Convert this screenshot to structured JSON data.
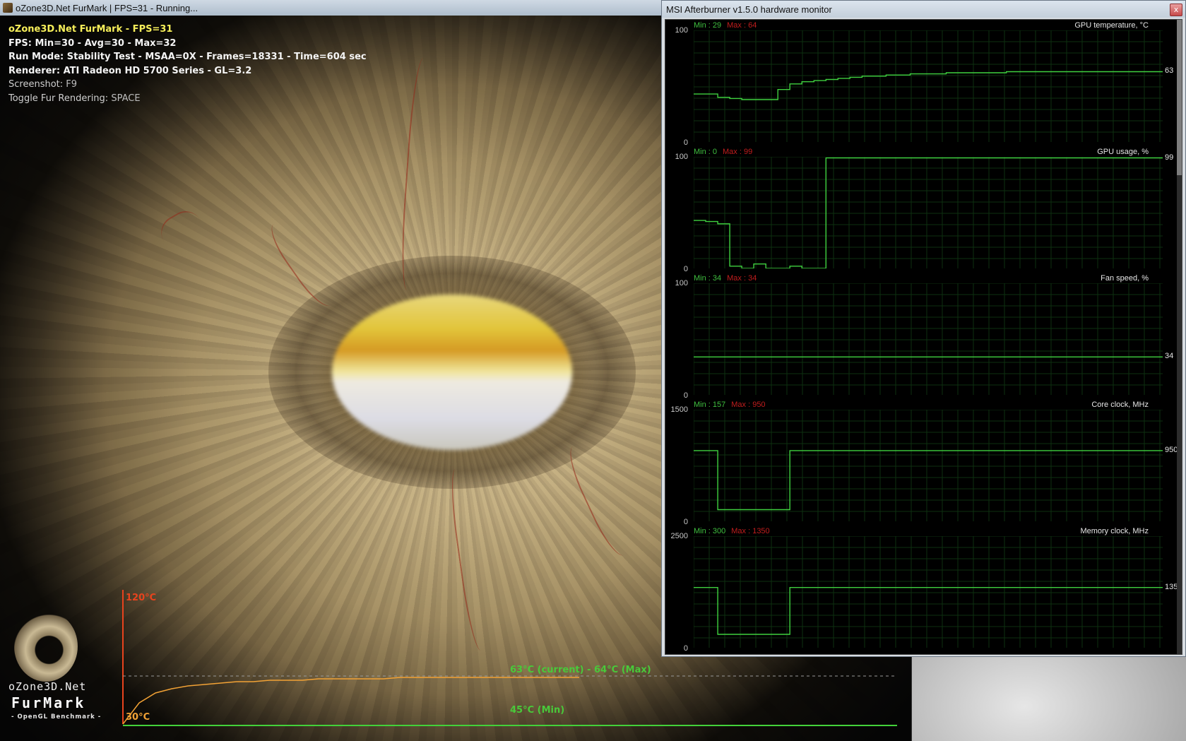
{
  "furmark": {
    "window_title": "oZone3D.Net FurMark | FPS=31 - Running...",
    "overlay": {
      "line1": "oZone3D.Net FurMark - FPS=31",
      "line2": "FPS: Min=30 - Avg=30 - Max=32",
      "line3": "Run Mode: Stability Test - MSAA=0X - Frames=18331 - Time=604 sec",
      "line4": "Renderer: ATI Radeon HD 5700 Series - GL=3.2",
      "line5_prefix": "Screenshot: ",
      "line5_key": "F9",
      "line6_prefix": "Toggle Fur Rendering: ",
      "line6_key": "SPACE"
    },
    "logo": {
      "name_top": "oZone3D.Net",
      "name_main": "FurMark",
      "tagline": "- OpenGL Benchmark -"
    },
    "temp_graph": {
      "max_label": "120°C",
      "min_axis_label": "30°C",
      "current_label": "63°C (current) - 64°C (Max)",
      "min_label": "45°C (Min)",
      "colors": {
        "axis": "#e8431d",
        "curve": "#f2a235",
        "text_green": "#49c93a",
        "baseline": "#43d13a"
      },
      "y_range": [
        30,
        120
      ],
      "series": [
        30,
        45,
        52,
        55,
        57,
        58,
        59,
        60,
        60,
        61,
        61,
        61,
        62,
        62,
        62,
        62,
        62,
        63,
        63,
        63,
        63,
        63,
        63,
        63,
        63,
        63,
        63,
        63,
        63
      ]
    }
  },
  "afterburner": {
    "window_title": "MSI Afterburner v1.5.0 hardware monitor",
    "close_label": "x",
    "monitors": [
      {
        "title": "GPU temperature, °C",
        "y_max": "100",
        "y_min": "0",
        "min_text": "Min : 29",
        "max_text": "Max : 64",
        "current": "63",
        "range": [
          0,
          100
        ],
        "series": [
          43,
          43,
          40,
          39,
          38,
          38,
          38,
          47,
          52,
          54,
          55,
          56,
          57,
          58,
          59,
          59,
          60,
          60,
          61,
          61,
          61,
          62,
          62,
          62,
          62,
          62,
          63,
          63,
          63,
          63,
          63,
          63,
          63,
          63,
          63,
          63,
          63,
          63,
          63,
          63
        ]
      },
      {
        "title": "GPU usage, %",
        "y_max": "100",
        "y_min": "0",
        "min_text": "Min : 0",
        "max_text": "Max : 99",
        "current": "99",
        "range": [
          0,
          100
        ],
        "series": [
          43,
          42,
          40,
          2,
          0,
          4,
          0,
          0,
          2,
          0,
          0,
          99,
          99,
          99,
          99,
          99,
          99,
          99,
          99,
          99,
          99,
          99,
          99,
          99,
          99,
          99,
          99,
          99,
          99,
          99,
          99,
          99,
          99,
          99,
          99,
          99,
          99,
          99,
          99,
          99
        ]
      },
      {
        "title": "Fan speed, %",
        "y_max": "100",
        "y_min": "0",
        "min_text": "Min : 34",
        "max_text": "Max : 34",
        "current": "34",
        "range": [
          0,
          100
        ],
        "series": [
          34,
          34,
          34,
          34,
          34,
          34,
          34,
          34,
          34,
          34,
          34,
          34,
          34,
          34,
          34,
          34,
          34,
          34,
          34,
          34,
          34,
          34,
          34,
          34,
          34,
          34,
          34,
          34,
          34,
          34,
          34,
          34,
          34,
          34,
          34,
          34,
          34,
          34,
          34,
          34
        ]
      },
      {
        "title": "Core clock, MHz",
        "y_max": "1500",
        "y_min": "0",
        "min_text": "Min : 157",
        "max_text": "Max : 950",
        "current": "950",
        "range": [
          0,
          1500
        ],
        "series": [
          950,
          950,
          157,
          157,
          157,
          157,
          157,
          157,
          950,
          950,
          950,
          950,
          950,
          950,
          950,
          950,
          950,
          950,
          950,
          950,
          950,
          950,
          950,
          950,
          950,
          950,
          950,
          950,
          950,
          950,
          950,
          950,
          950,
          950,
          950,
          950,
          950,
          950,
          950,
          950
        ]
      },
      {
        "title": "Memory clock, MHz",
        "y_max": "2500",
        "y_min": "0",
        "min_text": "Min : 300",
        "max_text": "Max : 1350",
        "current": "1350",
        "range": [
          0,
          2500
        ],
        "series": [
          1350,
          1350,
          300,
          300,
          300,
          300,
          300,
          300,
          1350,
          1350,
          1350,
          1350,
          1350,
          1350,
          1350,
          1350,
          1350,
          1350,
          1350,
          1350,
          1350,
          1350,
          1350,
          1350,
          1350,
          1350,
          1350,
          1350,
          1350,
          1350,
          1350,
          1350,
          1350,
          1350,
          1350,
          1350,
          1350,
          1350,
          1350,
          1350
        ]
      }
    ],
    "colors": {
      "line": "#3fd13f",
      "grid": "#0e3010",
      "background": "#000000"
    }
  }
}
